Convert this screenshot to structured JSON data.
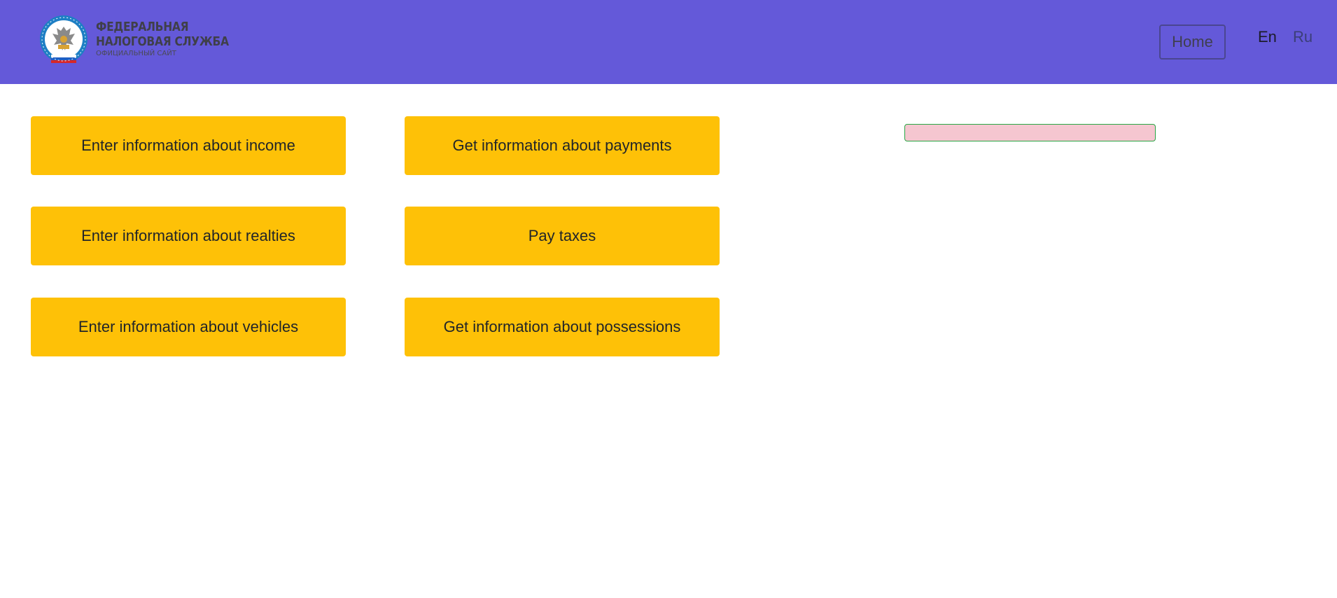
{
  "header": {
    "logo": {
      "line1": "ФЕДЕРАЛЬНАЯ",
      "line2": "НАЛОГОВАЯ СЛУЖБА",
      "line3": "ОФИЦИАЛЬНЫЙ САЙТ",
      "emblem_text": "ФЕДЕРАЛЬНАЯ НАЛОГОВАЯ СЛУЖБА"
    },
    "nav": {
      "home_label": "Home"
    },
    "languages": {
      "en": "En",
      "ru": "Ru"
    },
    "colors": {
      "background": "#6459d9"
    }
  },
  "actions": {
    "income": "Enter information about income",
    "payments": "Get information about payments",
    "realties": "Enter information about realties",
    "pay_taxes": "Pay taxes",
    "vehicles": "Enter information about vehicles",
    "possessions": "Get information about possessions",
    "color": "#fec107"
  },
  "status": {
    "text": "",
    "background": "#f5c6d0",
    "border": "#28a745"
  }
}
